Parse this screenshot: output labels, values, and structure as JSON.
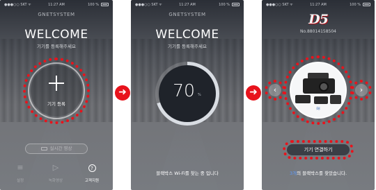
{
  "status_bar": {
    "carrier": "●●●○○ SKT ᯤ",
    "time": "11:27 AM",
    "battery": "100 %"
  },
  "screen1": {
    "brand": "GNETSYSTEM",
    "welcome": "WELCOME",
    "subtitle": "기기를 등록해주세요",
    "register_label": "기기 등록",
    "live_video_label": "실시간 영상",
    "tabs": [
      {
        "label": "설정",
        "icon": "≡"
      },
      {
        "label": "녹화영상",
        "icon": "▷"
      },
      {
        "label": "고객지원",
        "icon": "?"
      }
    ]
  },
  "screen2": {
    "brand": "GNETSYSTEM",
    "welcome": "WELCOME",
    "subtitle": "기기를 등록해주세요",
    "progress_value": "70",
    "progress_unit": "%",
    "progress_fraction": 0.7,
    "search_text": "블랙박스 Wi-Fi를 찾는 중 입니다"
  },
  "screen3": {
    "logo": "D5",
    "device_number": "No.8801415850​4",
    "prev_icon": "‹",
    "next_icon": "›",
    "wifi_icon": "≋",
    "connect_label": "기기 연결하기",
    "found_count": "3개",
    "found_suffix": "의 블랙박스를 찾았습니다."
  },
  "arrows": {
    "icon": "➜"
  },
  "colors": {
    "highlight": "#e8131c",
    "accent_blue": "#5e9cff"
  }
}
